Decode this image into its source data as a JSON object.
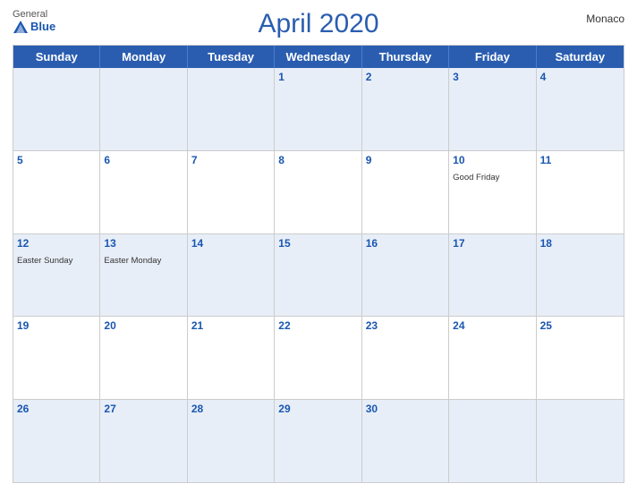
{
  "header": {
    "title": "April 2020",
    "country": "Monaco",
    "logo": {
      "general": "General",
      "blue": "Blue"
    }
  },
  "days_of_week": [
    "Sunday",
    "Monday",
    "Tuesday",
    "Wednesday",
    "Thursday",
    "Friday",
    "Saturday"
  ],
  "weeks": [
    [
      {
        "num": "",
        "event": ""
      },
      {
        "num": "",
        "event": ""
      },
      {
        "num": "",
        "event": ""
      },
      {
        "num": "1",
        "event": ""
      },
      {
        "num": "2",
        "event": ""
      },
      {
        "num": "3",
        "event": ""
      },
      {
        "num": "4",
        "event": ""
      }
    ],
    [
      {
        "num": "5",
        "event": ""
      },
      {
        "num": "6",
        "event": ""
      },
      {
        "num": "7",
        "event": ""
      },
      {
        "num": "8",
        "event": ""
      },
      {
        "num": "9",
        "event": ""
      },
      {
        "num": "10",
        "event": "Good Friday"
      },
      {
        "num": "11",
        "event": ""
      }
    ],
    [
      {
        "num": "12",
        "event": "Easter Sunday"
      },
      {
        "num": "13",
        "event": "Easter Monday"
      },
      {
        "num": "14",
        "event": ""
      },
      {
        "num": "15",
        "event": ""
      },
      {
        "num": "16",
        "event": ""
      },
      {
        "num": "17",
        "event": ""
      },
      {
        "num": "18",
        "event": ""
      }
    ],
    [
      {
        "num": "19",
        "event": ""
      },
      {
        "num": "20",
        "event": ""
      },
      {
        "num": "21",
        "event": ""
      },
      {
        "num": "22",
        "event": ""
      },
      {
        "num": "23",
        "event": ""
      },
      {
        "num": "24",
        "event": ""
      },
      {
        "num": "25",
        "event": ""
      }
    ],
    [
      {
        "num": "26",
        "event": ""
      },
      {
        "num": "27",
        "event": ""
      },
      {
        "num": "28",
        "event": ""
      },
      {
        "num": "29",
        "event": ""
      },
      {
        "num": "30",
        "event": ""
      },
      {
        "num": "",
        "event": ""
      },
      {
        "num": "",
        "event": ""
      }
    ]
  ],
  "shading": [
    "row-shaded",
    "row-unshaded",
    "row-shaded",
    "row-unshaded",
    "row-shaded"
  ]
}
